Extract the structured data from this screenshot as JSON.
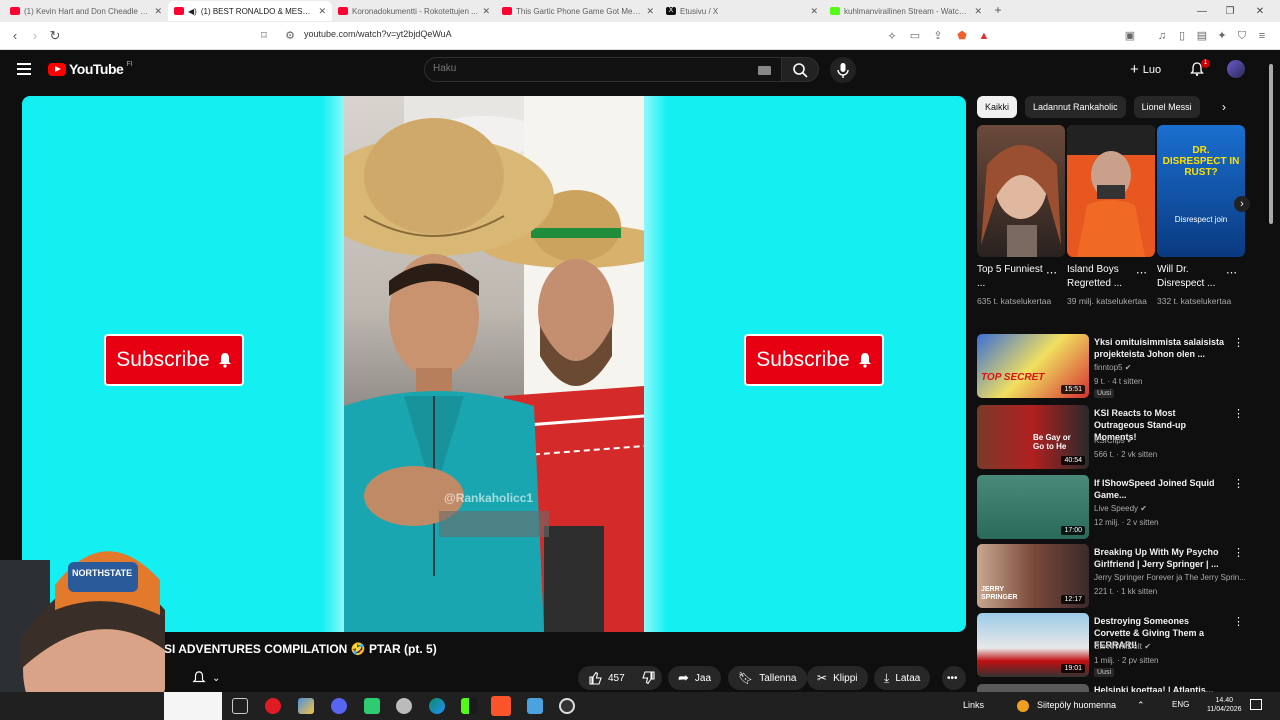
{
  "browser": {
    "tabs": [
      {
        "label": "(1) Kevin Hart and Don Cheadle DA...",
        "icon": "youtube-icon",
        "active": false
      },
      {
        "label": "(1) BEST RONALDO & MESSI...",
        "icon": "youtube-icon",
        "active": true
      },
      {
        "label": "Koronadokumentti - Rokotettujen ...",
        "icon": "youtube-icon",
        "active": false
      },
      {
        "label": "This Gartic Phone Game Got Me Can...",
        "icon": "youtube-icon",
        "active": false
      },
      {
        "label": "Etusivu / X",
        "icon": "x-icon",
        "active": false
      },
      {
        "label": "kuhlmanvirallinen Stream - Watch Li...",
        "icon": "kick-icon",
        "active": false
      }
    ],
    "url": "youtube.com/watch?v=yt2bjdQeWuA"
  },
  "header": {
    "logo_text": "YouTube",
    "logo_country": "FI",
    "search_placeholder": "Haku",
    "create_label": "Luo",
    "notification_count": "1"
  },
  "player": {
    "subscribe_left": "Subscribe",
    "subscribe_right": "Subscribe",
    "watermark": "@Rankaholicc1"
  },
  "video": {
    "title": "SI ADVENTURES COMPILATION 🤣 PTAR (pt. 5)",
    "likes": "457",
    "share_label": "Jaa",
    "save_label": "Tallenna",
    "clip_label": "Klippi",
    "download_label": "Lataa"
  },
  "sidebar": {
    "chips": [
      "Kaikki",
      "Ladannut Rankaholic",
      "Lionel Messi"
    ],
    "shorts": [
      {
        "title": "Top 5 Funniest ...",
        "views": "635 t. katselukertaa"
      },
      {
        "title": "Island Boys Regretted ...",
        "views": "39 milj. katselukertaa"
      },
      {
        "title": "Will Dr. Disrespect ...",
        "views": "332 t. katselukertaa",
        "thumb_text": "DR. DISRESPECT IN RUST?",
        "thumb_sub": "Disrespect join"
      }
    ],
    "videos": [
      {
        "title": "Yksi omituisimmista salaisista projekteista Johon olen ...",
        "channel": "finntop5",
        "meta": "9 t. · 4 t sitten",
        "badge": "Uusi",
        "duration": "15:51",
        "thumb_text": "TOP SECRET"
      },
      {
        "title": "KSI Reacts to Most Outrageous Stand-up Moments!",
        "channel": "KSIClips",
        "meta": "566 t. · 2 vk sitten",
        "badge": "",
        "duration": "40:54",
        "thumb_text": "Be Gay or Go to He"
      },
      {
        "title": "If IShowSpeed Joined Squid Game...",
        "channel": "Live Speedy",
        "meta": "12 milj. · 2 v sitten",
        "badge": "",
        "duration": "17:00",
        "thumb_text": ""
      },
      {
        "title": "Breaking Up With My Psycho Girlfriend | Jerry Springer | ...",
        "channel": "Jerry Springer Forever ja The Jerry Sprin...",
        "meta": "221 t. · 1 kk sitten",
        "badge": "",
        "duration": "12:17",
        "thumb_text": "JERRY SPRINGER"
      },
      {
        "title": "Destroying Someones Corvette & Giving Them a FERRARI!",
        "channel": "SteveWillDoIt",
        "meta": "1 milj. · 2 pv sitten",
        "badge": "Uusi",
        "duration": "19:01",
        "thumb_text": ""
      },
      {
        "title": "Helsinki koettaa! | Atlantis...",
        "channel": "",
        "meta": "",
        "badge": "",
        "duration": "",
        "thumb_text": ""
      }
    ]
  },
  "taskbar": {
    "links_label": "Links",
    "weather": "Siitepöly huomenna",
    "lang": "ENG",
    "time": "14.40",
    "date": "11/04/2026"
  }
}
